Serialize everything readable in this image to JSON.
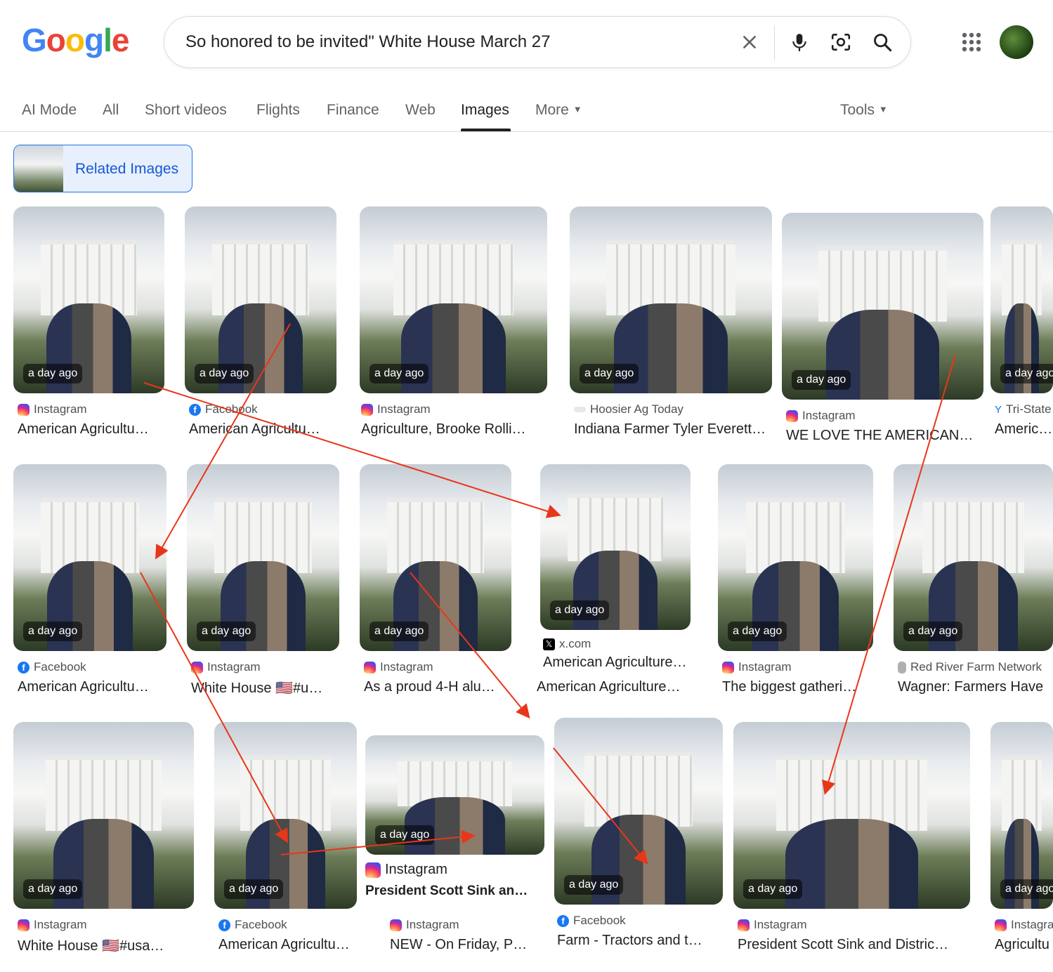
{
  "search": {
    "query": "So honored to be invited\" White House March 27"
  },
  "logo": [
    "G",
    "o",
    "o",
    "g",
    "l",
    "e"
  ],
  "tabs": [
    "AI Mode",
    "All",
    "Short videos",
    "Flights",
    "Finance",
    "Web",
    "Images",
    "More"
  ],
  "tools_label": "Tools",
  "related_label": "Related Images",
  "badge": "a day ago",
  "colors": {
    "logo_blue": "#4285f4",
    "logo_red": "#ea4335",
    "logo_yellow": "#fbbc05",
    "logo_green": "#34a853",
    "accent": "#1a73e8",
    "arrow": "#e8361b"
  },
  "cards": [
    {
      "source": "Instagram",
      "title": "American Agricultu…",
      "icon": "instagram-icon"
    },
    {
      "source": "Facebook",
      "title": "American Agricultu…",
      "icon": "facebook-icon"
    },
    {
      "source": "Instagram",
      "title": "Agriculture, Brooke Rolli…",
      "icon": "instagram-icon"
    },
    {
      "source": "Hoosier Ag Today",
      "title": "Indiana Farmer Tyler Everett…",
      "icon": "hoosier-icon"
    },
    {
      "source": "Instagram",
      "title": "WE LOVE THE AMERICAN…",
      "icon": "instagram-icon"
    },
    {
      "source": "Tri-State",
      "title": "American",
      "icon": "tristate-icon"
    },
    {
      "source": "Facebook",
      "title": "American Agricultu…",
      "icon": "facebook-icon"
    },
    {
      "source": "Instagram",
      "title": "White House 🇺🇸#u…",
      "icon": "instagram-icon"
    },
    {
      "source": "Instagram",
      "title": "As a proud 4-H alu…",
      "icon": "instagram-icon"
    },
    {
      "source": "x.com",
      "title": "American Agriculture …",
      "icon": "x-icon"
    },
    {
      "source": "Instagram",
      "title": "The biggest gatheri…",
      "icon": "instagram-icon"
    },
    {
      "source": "Red River Farm Network",
      "title": "Wagner: Farmers Have",
      "icon": "redriver-icon"
    },
    {
      "source": "Instagram",
      "title": "White House 🇺🇸#usa…",
      "icon": "instagram-icon"
    },
    {
      "source": "Facebook",
      "title": "American Agricultu…",
      "icon": "facebook-icon"
    },
    {
      "source": "Instagram",
      "title": "NEW - On Friday, P…",
      "icon": "instagram-icon"
    },
    {
      "source": "Facebook",
      "title": "Farm - Tractors and t…",
      "icon": "facebook-icon"
    },
    {
      "source": "Instagram",
      "title": "President Scott Sink and Distric…",
      "icon": "instagram-icon"
    },
    {
      "source": "Instagram",
      "title": "Agricultu",
      "icon": "instagram-icon"
    }
  ],
  "overlay_card": {
    "source": "Instagram",
    "title": "President Scott Sink and…",
    "icon": "instagram-icon"
  },
  "hover_subtitle": "American Agriculture …",
  "hover_title": "American Agriculture…"
}
